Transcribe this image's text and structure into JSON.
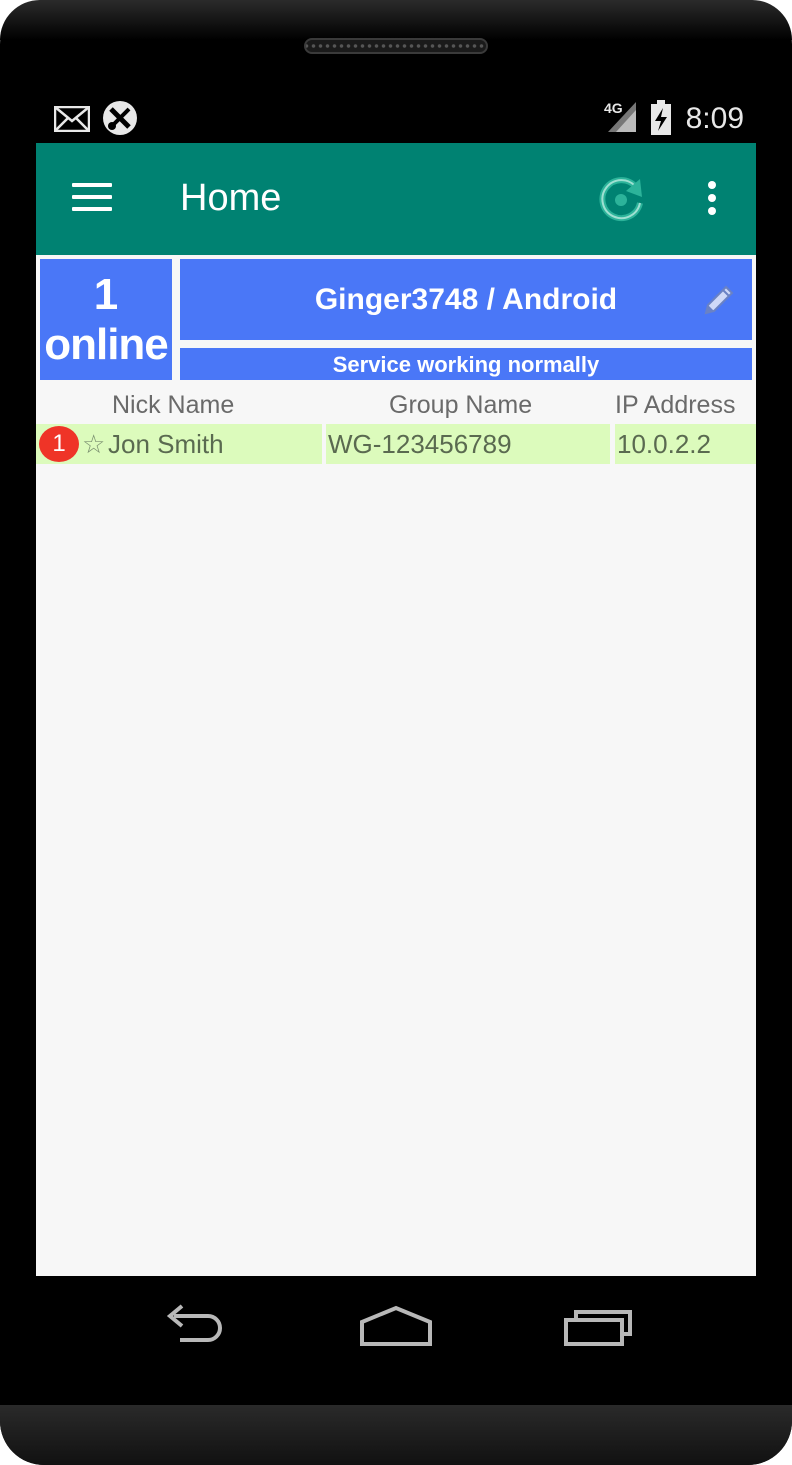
{
  "status_bar": {
    "time": "8:09",
    "network_label": "4G",
    "icons": [
      "mail-icon",
      "tools-icon",
      "signal-icon",
      "battery-charging-icon"
    ]
  },
  "app_bar": {
    "title": "Home",
    "icons": [
      "menu-icon",
      "refresh-icon",
      "overflow-menu-icon"
    ]
  },
  "summary": {
    "online_count": "1",
    "online_label": "online",
    "device_name": "Ginger3748 / Android",
    "service_status": "Service working normally"
  },
  "table": {
    "headers": [
      "Nick Name",
      "Group Name",
      "IP Address"
    ],
    "rows": [
      {
        "rank": "1",
        "star": "☆",
        "nick": "Jon Smith",
        "group": "WG-123456789",
        "ip": "10.0.2.2"
      }
    ]
  },
  "nav_bar": {
    "icons": [
      "back-icon",
      "home-icon",
      "recent-apps-icon"
    ]
  },
  "colors": {
    "app_bar": "#008272",
    "summary_blue": "#4a77f7",
    "row_highlight": "#dcfbbc",
    "badge_red": "#ef3427"
  }
}
